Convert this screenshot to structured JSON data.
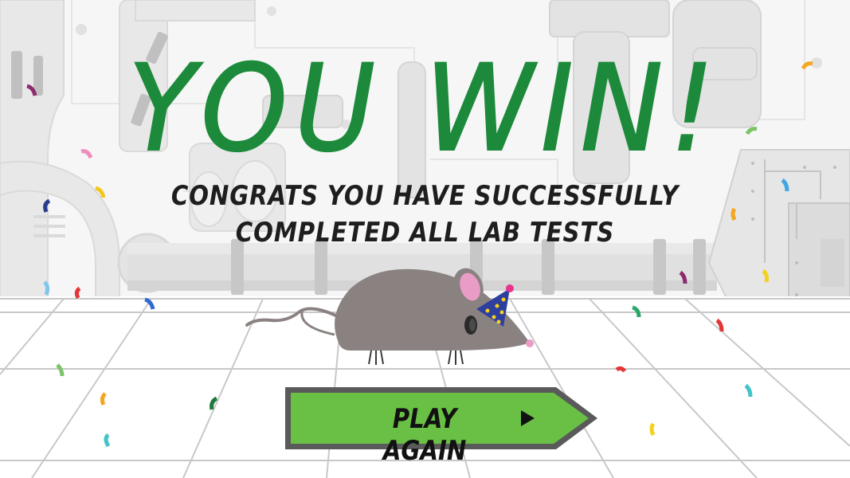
{
  "title": "YOU WIN!",
  "subtitle_line1": "CONGRATS YOU HAVE SUCCESSFULLY",
  "subtitle_line2": "COMPLETED ALL LAB TESTS",
  "play_again_label": "PLAY AGAIN",
  "icons": {
    "play": "play-triangle-icon",
    "mouse": "party-mouse",
    "hat": "party-hat-icon"
  },
  "colors": {
    "title": "#1c8a3a",
    "button_fill": "#6abf45",
    "button_border": "#5a5a5a",
    "mouse_body": "#8a8280",
    "mouse_ear": "#e89cc6",
    "hat": "#2e3f9e",
    "hat_dots": "#f2d21e",
    "pompom": "#e8338a"
  }
}
